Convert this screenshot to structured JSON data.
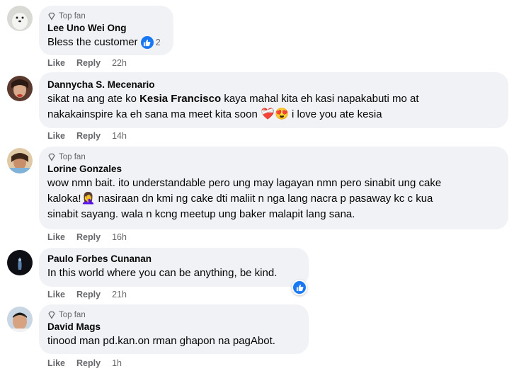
{
  "comments": [
    {
      "badge": "Top fan",
      "name": "Lee Uno Wei Ong",
      "text": "Bless the customer",
      "reaction_count": "2",
      "like": "Like",
      "reply": "Reply",
      "time": "22h"
    },
    {
      "name": "Dannycha S. Mecenario",
      "text_a": "sikat na ang ate ko ",
      "mention": "Kesia Francisco",
      "text_b": " kaya mahal kita eh kasi napakabuti mo at",
      "text_c": "nakakainspire ka eh sana ma meet kita soon ",
      "text_d": " i love you ate kesia",
      "emoji_1": "❤️‍🩹",
      "emoji_2": "😍",
      "like": "Like",
      "reply": "Reply",
      "time": "14h"
    },
    {
      "badge": "Top fan",
      "name": "Lorine Gonzales",
      "line1": "wow nmn bait. ito understandable pero ung may lagayan nmn pero sinabit ung cake",
      "line2a": "kaloka!",
      "line2b": " nasiraan dn kmi ng cake dti maliit n nga lang nacra p pasaway kc c kua",
      "line3": "sinabit sayang. wala n kcng meetup ung baker malapit lang sana.",
      "emoji": "🤦‍♀️",
      "like": "Like",
      "reply": "Reply",
      "time": "16h"
    },
    {
      "name": "Paulo Forbes Cunanan",
      "text": "In this world where you can be anything, be kind.",
      "like": "Like",
      "reply": "Reply",
      "time": "21h"
    },
    {
      "badge": "Top fan",
      "name": "David Mags",
      "text": "tinood man pd.kan.on rman ghapon na pagAbot.",
      "like": "Like",
      "reply": "Reply",
      "time": "1h"
    }
  ],
  "colors": {
    "bubble": "#f0f2f5",
    "meta": "#65676b",
    "like_blue": "#1877f2"
  }
}
